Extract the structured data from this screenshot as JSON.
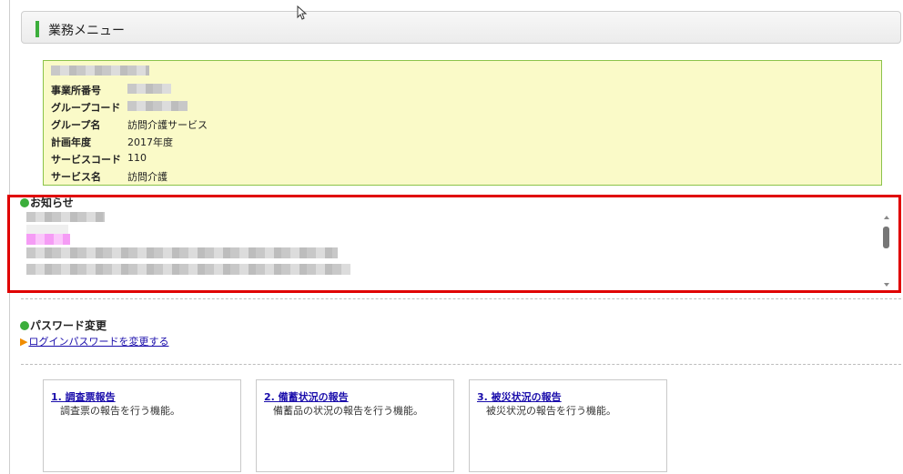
{
  "menu_header": {
    "title": "業務メニュー"
  },
  "info": {
    "rows": [
      {
        "label": "事業所番号",
        "value": ""
      },
      {
        "label": "グループコード",
        "value": ""
      },
      {
        "label": "グループ名",
        "value": "訪問介護サービス"
      },
      {
        "label": "計画年度",
        "value": "2017年度"
      },
      {
        "label": "サービスコード",
        "value": "110"
      },
      {
        "label": "サービス名",
        "value": "訪問介護"
      }
    ]
  },
  "notice": {
    "title": "お知らせ"
  },
  "password": {
    "title": "パスワード変更",
    "link": "ログインパスワードを変更する"
  },
  "cards": [
    {
      "title": "1. 調査票報告",
      "desc": "調査票の報告を行う機能。"
    },
    {
      "title": "2. 備蓄状況の報告",
      "desc": "備蓄品の状況の報告を行う機能。"
    },
    {
      "title": "3. 被災状況の報告",
      "desc": "被災状況の報告を行う機能。"
    }
  ],
  "colors": {
    "accent_green": "#3cae3c",
    "highlight_red": "#e00000",
    "info_bg": "#fafac8",
    "link": "#1a0dab"
  }
}
